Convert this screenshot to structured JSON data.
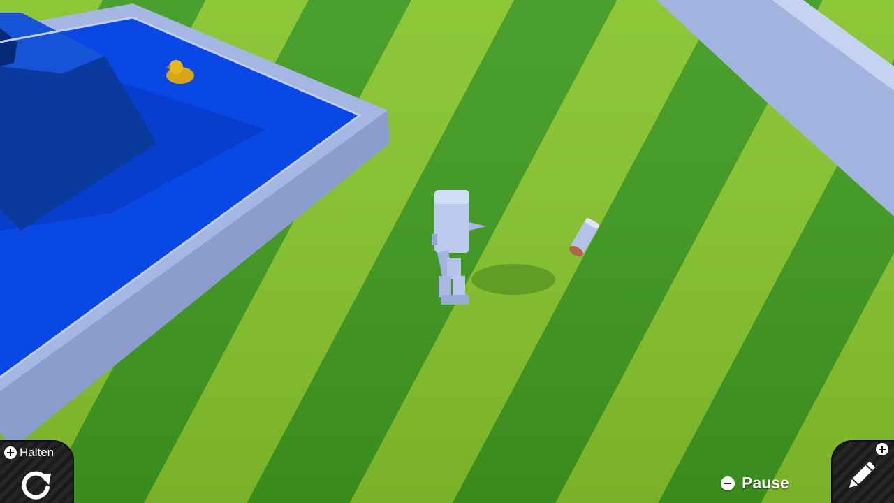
{
  "hud": {
    "reset_hint_label": "Halten",
    "pause_label": "Pause"
  },
  "icons": {
    "reset": "reset-rotate-icon",
    "edit": "pencil-icon",
    "plus": "plus-button-icon",
    "minus": "minus-button-icon"
  },
  "colors": {
    "grass_light": "#7cbf2a",
    "grass_dark": "#3e9a1e",
    "pool_water": "#0a48e6",
    "pool_rim": "#a9b9e4",
    "wall": "#9fb1e0",
    "duck": "#e2b21a",
    "robot": "#b9c7ef"
  }
}
